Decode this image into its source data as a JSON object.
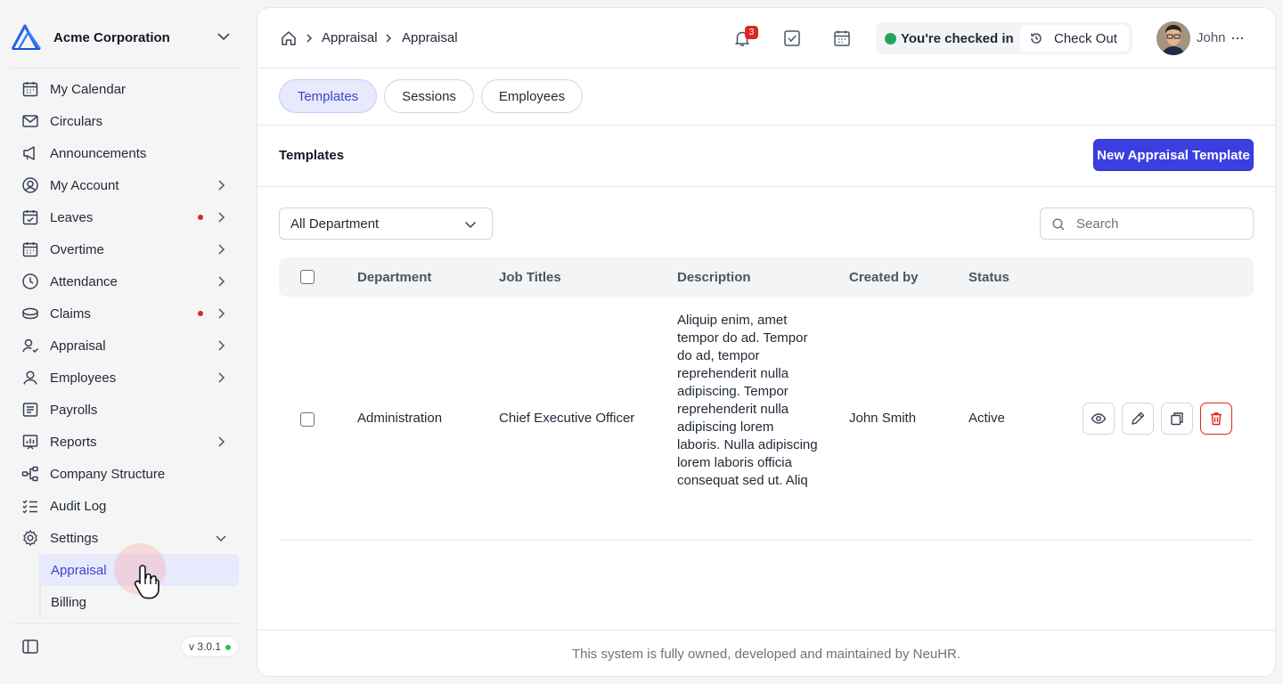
{
  "org": {
    "name": "Acme Corporation"
  },
  "sidebar": {
    "items": [
      {
        "label": "My Calendar",
        "icon": "calendar-icon"
      },
      {
        "label": "Circulars",
        "icon": "mail-icon"
      },
      {
        "label": "Announcements",
        "icon": "megaphone-icon"
      },
      {
        "label": "My Account",
        "icon": "user-circle-icon"
      },
      {
        "label": "Leaves",
        "icon": "calendar-check-icon"
      },
      {
        "label": "Overtime",
        "icon": "calendar-icon"
      },
      {
        "label": "Attendance",
        "icon": "clock-icon"
      },
      {
        "label": "Claims",
        "icon": "coins-icon"
      },
      {
        "label": "Appraisal",
        "icon": "user-check-icon"
      },
      {
        "label": "Employees",
        "icon": "user-icon"
      },
      {
        "label": "Payrolls",
        "icon": "receipt-icon"
      },
      {
        "label": "Reports",
        "icon": "chart-icon"
      },
      {
        "label": "Company Structure",
        "icon": "hierarchy-icon"
      },
      {
        "label": "Audit Log",
        "icon": "checklist-icon"
      },
      {
        "label": "Settings",
        "icon": "gear-icon"
      }
    ],
    "settings_sub": [
      {
        "label": "Appraisal"
      },
      {
        "label": "Billing"
      }
    ],
    "version": "v 3.0.1"
  },
  "header": {
    "breadcrumb": [
      "Appraisal",
      "Appraisal"
    ],
    "notification_count": "3",
    "checkin_status": "You're checked in",
    "checkout_label": "Check Out",
    "user_name": "John"
  },
  "tabs": [
    {
      "label": "Templates",
      "active": true
    },
    {
      "label": "Sessions",
      "active": false
    },
    {
      "label": "Employees",
      "active": false
    }
  ],
  "section": {
    "title": "Templates",
    "new_button": "New Appraisal Template"
  },
  "filters": {
    "department_selected": "All Department",
    "search_placeholder": "Search"
  },
  "table": {
    "columns": [
      "Department",
      "Job Titles",
      "Description",
      "Created by",
      "Status"
    ],
    "rows": [
      {
        "department": "Administration",
        "job_titles": "Chief Executive Officer",
        "description": "Aliquip enim, amet tempor do ad. Tempor do ad, tempor reprehenderit nulla adipiscing. Tempor reprehenderit nulla adipiscing lorem laboris. Nulla adipiscing lorem laboris officia consequat sed ut. Aliq",
        "created_by": "John Smith",
        "status": "Active"
      }
    ]
  },
  "footer": {
    "text": "This system is fully owned, developed and maintained by NeuHR."
  },
  "colors": {
    "primary": "#3b3fe0",
    "active_tab_bg": "#e7e9fd",
    "danger": "#dc2626",
    "success": "#22a45d"
  }
}
